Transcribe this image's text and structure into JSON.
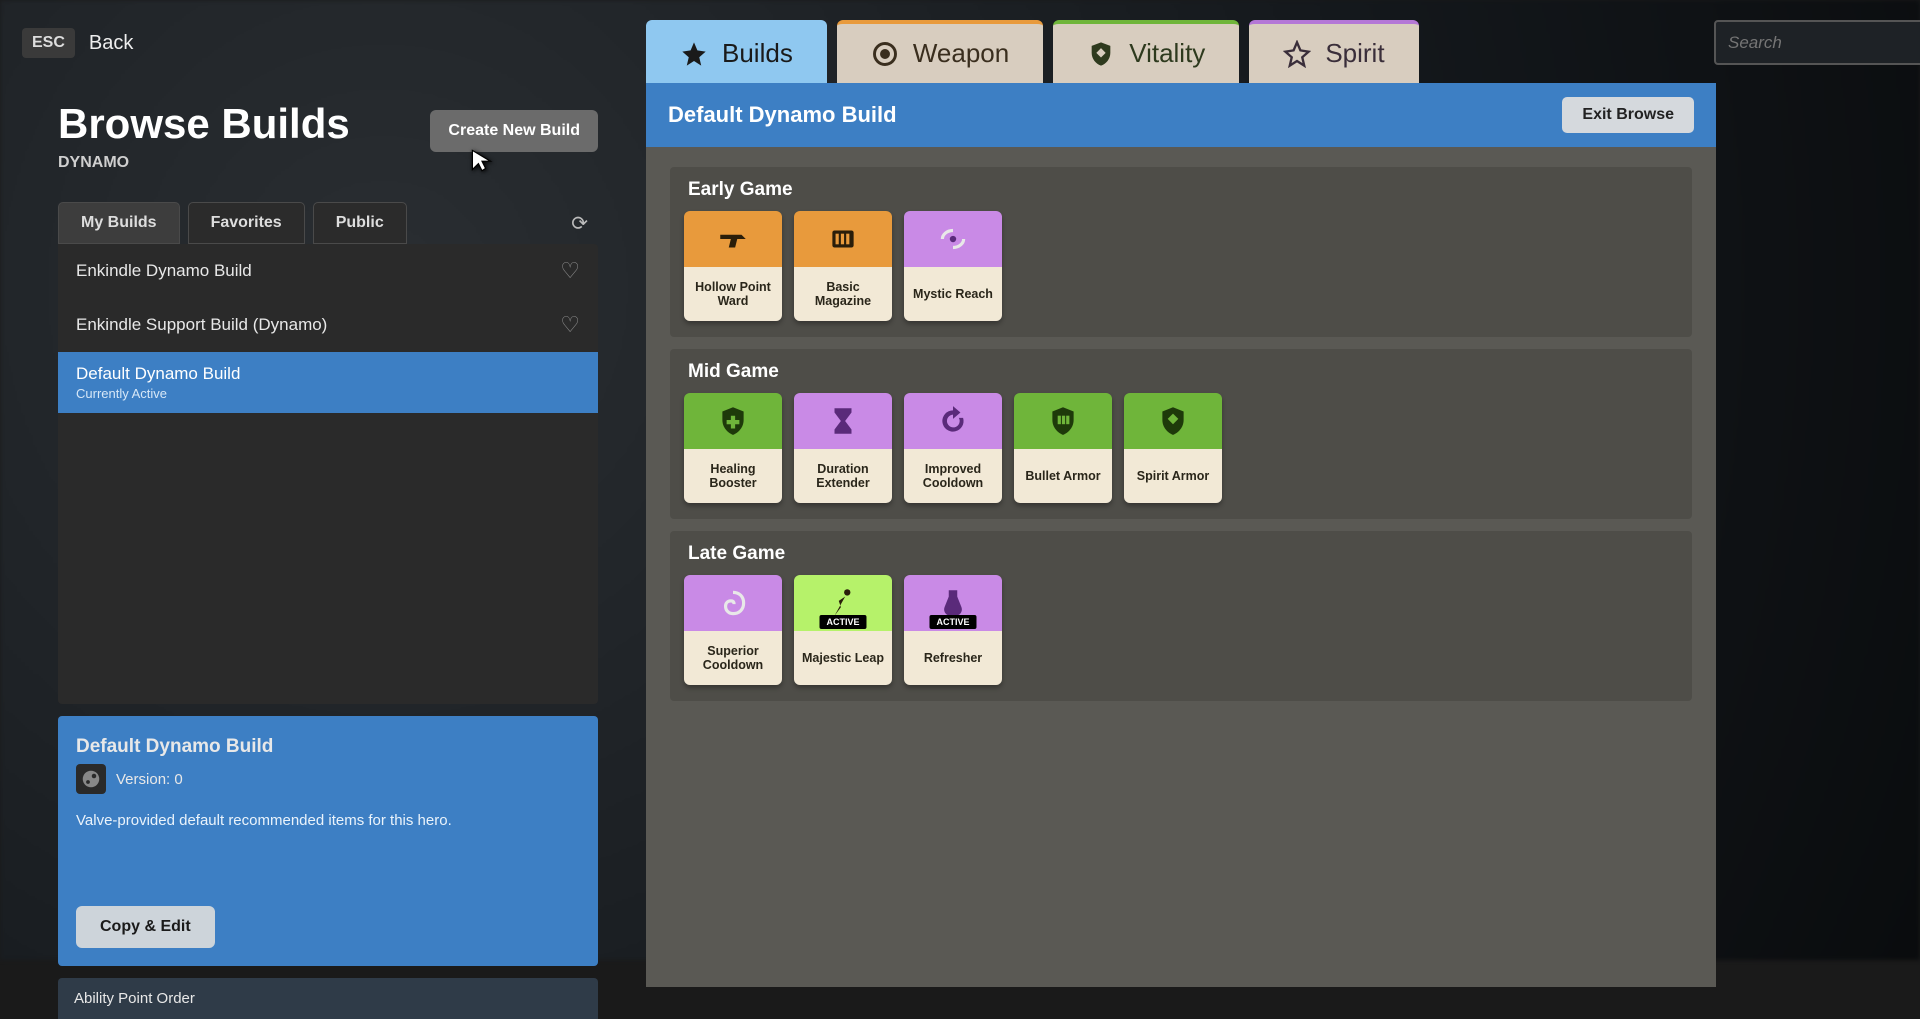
{
  "top": {
    "esc": "ESC",
    "back": "Back"
  },
  "left": {
    "title": "Browse Builds",
    "hero": "DYNAMO",
    "create_btn": "Create New Build",
    "filter_tabs": [
      "My Builds",
      "Favorites",
      "Public"
    ],
    "builds": [
      {
        "name": "Enkindle Dynamo Build",
        "active": false
      },
      {
        "name": "Enkindle Support Build (Dynamo)",
        "active": false
      },
      {
        "name": "Default Dynamo Build",
        "active": true,
        "subtext": "Currently Active"
      }
    ],
    "detail": {
      "title": "Default Dynamo Build",
      "version": "Version: 0",
      "desc": "Valve-provided default recommended items for this hero.",
      "copy_btn": "Copy & Edit"
    },
    "ability_section": "Ability Point Order"
  },
  "main": {
    "cat_tabs": [
      {
        "label": "Builds",
        "cls": "builds",
        "icon": "star",
        "active": true
      },
      {
        "label": "Weapon",
        "cls": "weapon",
        "icon": "target",
        "active": false
      },
      {
        "label": "Vitality",
        "cls": "vitality",
        "icon": "shield",
        "active": false
      },
      {
        "label": "Spirit",
        "cls": "spirit",
        "icon": "star-o",
        "active": false
      }
    ],
    "search_placeholder": "Search",
    "header_title": "Default Dynamo Build",
    "exit_btn": "Exit Browse",
    "phases": [
      {
        "title": "Early Game",
        "items": [
          {
            "name": "Hollow Point Ward",
            "color": "weapon",
            "icon": "gun"
          },
          {
            "name": "Basic Magazine",
            "color": "weapon",
            "icon": "mag"
          },
          {
            "name": "Mystic Reach",
            "color": "spirit",
            "icon": "wave"
          }
        ]
      },
      {
        "title": "Mid Game",
        "items": [
          {
            "name": "Healing Booster",
            "color": "vitality",
            "icon": "plus-shield"
          },
          {
            "name": "Duration Extender",
            "color": "spirit",
            "icon": "hourglass"
          },
          {
            "name": "Improved Cooldown",
            "color": "spirit",
            "icon": "refresh"
          },
          {
            "name": "Bullet Armor",
            "color": "vitality",
            "icon": "ammo-shield"
          },
          {
            "name": "Spirit Armor",
            "color": "vitality",
            "icon": "spirit-shield"
          }
        ]
      },
      {
        "title": "Late Game",
        "items": [
          {
            "name": "Superior Cooldown",
            "color": "spirit",
            "icon": "swirl"
          },
          {
            "name": "Majestic Leap",
            "color": "spirit-lt",
            "icon": "runner",
            "active_badge": true
          },
          {
            "name": "Refresher",
            "color": "spirit",
            "icon": "potion",
            "active_badge": true
          }
        ]
      }
    ]
  }
}
